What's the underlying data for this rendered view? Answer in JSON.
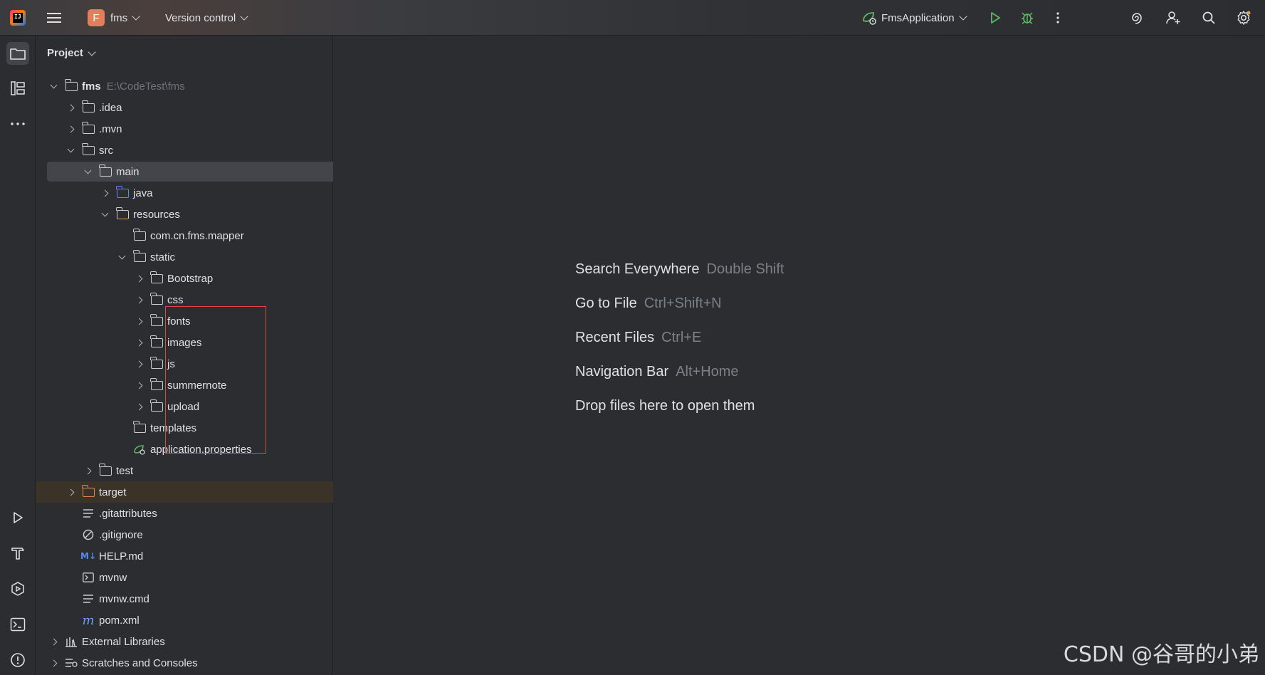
{
  "topbar": {
    "project_letter": "F",
    "project_name": "fms",
    "vcs_label": "Version control",
    "run_config": "FmsApplication"
  },
  "panel": {
    "title": "Project"
  },
  "tree": [
    {
      "label": "fms",
      "path": "E:\\CodeTest\\fms"
    },
    {
      "label": ".idea"
    },
    {
      "label": ".mvn"
    },
    {
      "label": "src"
    },
    {
      "label": "main"
    },
    {
      "label": "java"
    },
    {
      "label": "resources"
    },
    {
      "label": "com.cn.fms.mapper"
    },
    {
      "label": "static"
    },
    {
      "label": "Bootstrap"
    },
    {
      "label": "css"
    },
    {
      "label": "fonts"
    },
    {
      "label": "images"
    },
    {
      "label": "js"
    },
    {
      "label": "summernote"
    },
    {
      "label": "upload"
    },
    {
      "label": "templates"
    },
    {
      "label": "application.properties"
    },
    {
      "label": "test"
    },
    {
      "label": "target"
    },
    {
      "label": ".gitattributes"
    },
    {
      "label": ".gitignore"
    },
    {
      "label": "HELP.md"
    },
    {
      "label": "mvnw"
    },
    {
      "label": "mvnw.cmd"
    },
    {
      "label": "pom.xml"
    },
    {
      "label": "External Libraries"
    },
    {
      "label": "Scratches and Consoles"
    }
  ],
  "hints": [
    {
      "action": "Search Everywhere",
      "key": "Double Shift"
    },
    {
      "action": "Go to File",
      "key": "Ctrl+Shift+N"
    },
    {
      "action": "Recent Files",
      "key": "Ctrl+E"
    },
    {
      "action": "Navigation Bar",
      "key": "Alt+Home"
    },
    {
      "action": "Drop files here to open them",
      "key": ""
    }
  ],
  "watermark": "CSDN @谷哥的小弟",
  "colors": {
    "accent_run": "#5fb865",
    "highlight_box": "#e0454a",
    "folder_source": "#548af7",
    "folder_excluded": "#e08855"
  }
}
